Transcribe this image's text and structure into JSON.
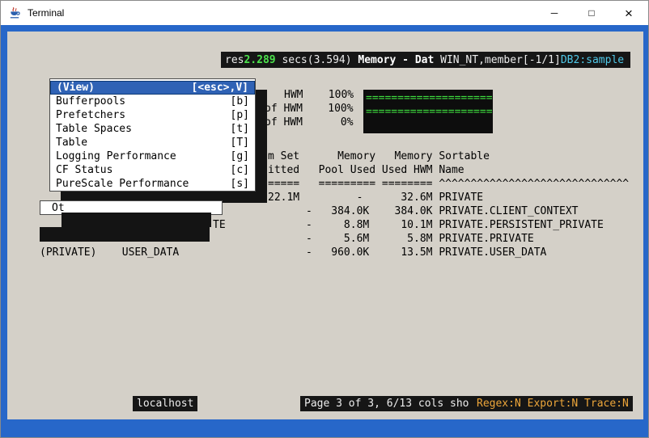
{
  "window": {
    "title": "Terminal",
    "controls": {
      "minimize": "─",
      "maximize": "□",
      "close": "×"
    }
  },
  "header": {
    "refresh_tail": "res",
    "time": "2.289",
    "secs": " secs(3.594) ",
    "screen_title": "Memory - Dat",
    "host_info": " WIN_NT,member[-1/1]",
    "db": "DB2:sample"
  },
  "menu": {
    "items": [
      {
        "label": "(View)",
        "key": "[<esc>,V]"
      },
      {
        "label": "Bufferpools",
        "key": "[b]"
      },
      {
        "label": "Prefetchers",
        "key": "[p]"
      },
      {
        "label": "Table Spaces",
        "key": "[t]"
      },
      {
        "label": "Table",
        "key": "[T]"
      },
      {
        "label": "Logging Performance",
        "key": "[g]"
      },
      {
        "label": "CF Status",
        "key": "[c]"
      },
      {
        "label": "PureScale Performance",
        "key": "[s]"
      }
    ]
  },
  "gauges": {
    "labels": [
      "HWM    100%",
      "of HWM    100%",
      "of HWM      0%"
    ],
    "bars": [
      "====================",
      "===================="
    ]
  },
  "table": {
    "lines": [
      "m Set      Memory   Memory Sortable",
      "itted   Pool Used Used HWM Name",
      "=====   ========= ======== ^^^^^^^^^^^^^^^^^^^^^^^^^^^^^^",
      "22.1M         -      32.6M PRIVATE",
      "      -   384.0K    384.0K PRIVATE.CLIENT_CONTEXT",
      "      -     8.8M     10.1M PRIVATE.PERSISTENT_PRIVATE",
      "      -     5.6M      5.8M PRIVATE.PRIVATE",
      "      -   960.0K     13.5M PRIVATE.USER_DATA"
    ],
    "left_fragment": "(PRIVATE)    USER_DATA",
    "hidden_fragment_te": "TE",
    "hidden_fragment_ot": "Ot"
  },
  "status": {
    "host": "localhost",
    "page_info": "Page 3 of 3, 6/13 cols sho",
    "flags": "Regex:N Export:N Trace:N"
  },
  "colors": {
    "frame_blue": "#2767c9",
    "screen_gray": "#d4d0c8",
    "accent_green": "#3fe03f",
    "accent_cyan": "#4fc8e8",
    "accent_orange": "#eda63a",
    "selection_blue": "#2f62b5"
  }
}
